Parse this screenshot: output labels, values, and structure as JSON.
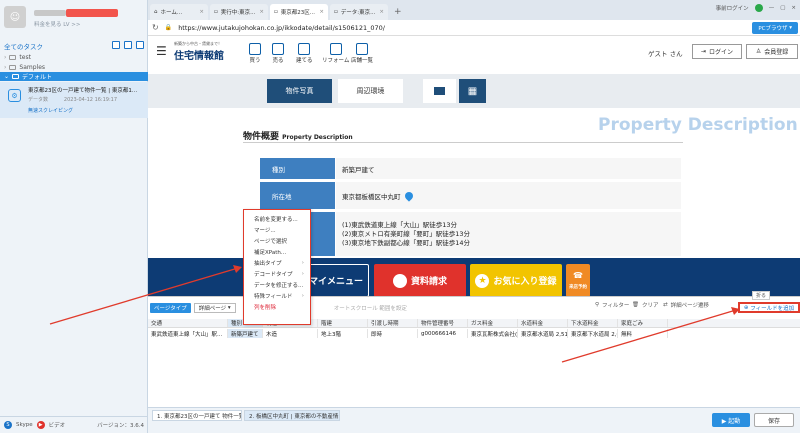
{
  "sidebar": {
    "upgrade_text": "料金を見る LV >>",
    "all_tasks": "全てのタスク",
    "folders": [
      "test",
      "Samples"
    ],
    "default_folder": "デフォルト",
    "task": {
      "title": "東京都23区の一戸建て物件一覧 | 東京都1...",
      "meta_label": "データ数",
      "date": "2023-04-12 16:19:17",
      "status": "無速スクレイピング"
    },
    "footer": {
      "skype": "Skype",
      "video": "ビデオ",
      "version": "バージョン：3.6.4"
    }
  },
  "browser": {
    "tabs": [
      {
        "label": "ホーム...",
        "active": false
      },
      {
        "label": "実行中:東京...",
        "active": false
      },
      {
        "label": "東京都23区...",
        "active": true
      },
      {
        "label": "データ:東京...",
        "active": false
      }
    ],
    "tab_plus": "+",
    "win_right": {
      "preview": "事前ログイン",
      "pc_browser": "PCブラウザ"
    },
    "url": "https://www.jutakujohokan.co.jp/ikkodate/detail/s1506121_070/"
  },
  "site": {
    "logo_sub": "新築から中古・賃貸まで！",
    "logo": "住宅情報館",
    "nav": [
      "買う",
      "売る",
      "建てる",
      "リフォーム",
      "店舗一覧"
    ],
    "guest": "ゲスト さん",
    "login": "ログイン",
    "register": "会員登録",
    "photo_btn": "物件写真",
    "env_btn": "周辺環境",
    "section_title": "物件概要",
    "section_title_en": "Property Description",
    "section_big": "Property Description",
    "rows": [
      {
        "label": "種別",
        "value": "新築戸建て"
      },
      {
        "label": "所在地",
        "value": "東京都板橋区中丸町"
      },
      {
        "label": "交通",
        "value": "(1)東武鉄道東上線「大山」駅徒歩13分\n(2)東京メトロ有楽町線「要町」駅徒歩13分\n(3)東京地下鉄副都心線「要町」駅徒歩14分"
      }
    ],
    "banner": {
      "mymenu": "マイメニュー",
      "request": "資料請求",
      "favorite": "お気に入り登録",
      "consult": "来店予約"
    }
  },
  "panel": {
    "page_type": "ページタイプ",
    "detail_page": "詳細ページ",
    "scroll_hint": "オートスクロール 範囲を設定",
    "filter": "フィルター",
    "clear": "クリア",
    "detail_jump": "詳細ページ遷移",
    "collapse": "折る",
    "add_field": "フィールドを追加",
    "columns": [
      "交通",
      "種別",
      "構造",
      "階建",
      "引渡し時期",
      "物件管理番号",
      "ガス料金",
      "水道料金",
      "下水道料金",
      "家庭ごみ"
    ],
    "row": [
      "東武鉄道東上線「大山」駅...",
      "新築戸建て",
      "木造",
      "地上3階",
      "即時",
      "g000666146",
      "東京瓦斯株式会社(東京...",
      "東京都水道局 2,516円",
      "東京都下水道局 2,068円",
      "無料"
    ]
  },
  "context_menu": [
    "名前を変更する...",
    "マージ...",
    "ページで選択",
    "補足XPath...",
    "抽出タイプ",
    "デコードタイプ",
    "データを修正する...",
    "特殊フィールド",
    "列を削除"
  ],
  "bottom": {
    "tabs": [
      "1. 東京都23区の一戸建て 物件一覧...",
      "2. 板橋区中丸町 | 東京都の不動産情..."
    ],
    "run": "▶ 起動",
    "save": "保存"
  },
  "colors": {
    "accent": "#2a8fe0",
    "site_navy": "#0d3b74",
    "label_blue": "#3e7fc0",
    "highlight_red": "#e03b2c"
  }
}
